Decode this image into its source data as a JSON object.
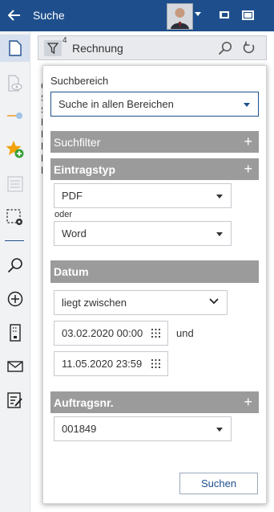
{
  "header": {
    "title": "Suche",
    "bg_color": "#1e4f8c"
  },
  "sidebar": {
    "items": [
      {
        "icon": "document-icon",
        "active": true
      },
      {
        "icon": "view-document-icon"
      },
      {
        "icon": "link-pin-icon"
      },
      {
        "icon": "favorite-add-icon"
      },
      {
        "icon": "list-icon"
      },
      {
        "icon": "selection-settings-icon"
      },
      {
        "icon": "search-icon"
      },
      {
        "icon": "add-circle-icon"
      },
      {
        "icon": "archive-device-icon"
      },
      {
        "icon": "mail-icon"
      },
      {
        "icon": "edit-list-icon"
      }
    ]
  },
  "searchbar": {
    "filter_count": "4",
    "query": "Rechnung"
  },
  "panel": {
    "scope_label": "Suchbereich",
    "scope_value": "Suche in allen Bereichen",
    "suchfilter_label": "Suchfilter",
    "eintragstyp_label": "Eintragstyp",
    "type_values": [
      "PDF",
      "Word"
    ],
    "or_label": "oder",
    "datum_label": "Datum",
    "date_operator": "liegt zwischen",
    "date_from": "03.02.2020 00:00",
    "and_label": "und",
    "date_to": "11.05.2020 23:59",
    "auftragsnr_label": "Auftragsnr.",
    "auftragsnr_value": "001849",
    "search_button": "Suchen"
  }
}
